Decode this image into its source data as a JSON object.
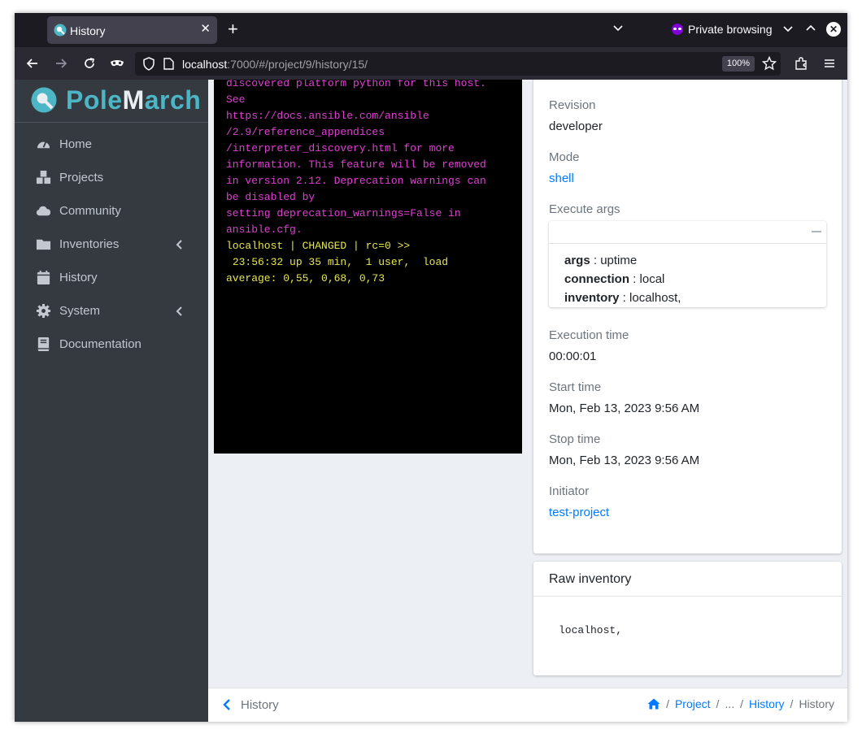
{
  "browser": {
    "tab_title": "History",
    "private_label": "Private browsing",
    "url_host": "localhost",
    "url_rest": ":7000/#/project/9/history/15/",
    "zoom": "100%"
  },
  "sidebar": {
    "brand_a": "Pole",
    "brand_b": "M",
    "brand_c": "arch",
    "items": [
      {
        "label": "Home"
      },
      {
        "label": "Projects"
      },
      {
        "label": "Community"
      },
      {
        "label": "Inventories"
      },
      {
        "label": "History"
      },
      {
        "label": "System"
      },
      {
        "label": "Documentation"
      }
    ]
  },
  "console": {
    "lines": [
      {
        "text": "discovered platform python for this host.",
        "kind": "warn"
      },
      {
        "text": "See",
        "kind": "warn"
      },
      {
        "text": "https://docs.ansible.com/ansible",
        "kind": "warn"
      },
      {
        "text": "/2.9/reference_appendices",
        "kind": "warn"
      },
      {
        "text": "/interpreter_discovery.html for more",
        "kind": "warn"
      },
      {
        "text": "information. This feature will be removed",
        "kind": "warn"
      },
      {
        "text": "in version 2.12. Deprecation warnings can",
        "kind": "warn"
      },
      {
        "text": "be disabled by",
        "kind": "warn"
      },
      {
        "text": "setting deprecation_warnings=False in",
        "kind": "warn"
      },
      {
        "text": "ansible.cfg.",
        "kind": "warn"
      },
      {
        "text": "localhost | CHANGED | rc=0 >>",
        "kind": "ok"
      },
      {
        "text": " 23:56:32 up 35 min,  1 user,  load",
        "kind": "ok"
      },
      {
        "text": "average: 0,55, 0,68, 0,73",
        "kind": "ok"
      }
    ]
  },
  "details": {
    "revision_label": "Revision",
    "revision": "developer",
    "mode_label": "Mode",
    "mode": "shell",
    "execute_args_label": "Execute args",
    "args": [
      {
        "key": "args",
        "value": "uptime"
      },
      {
        "key": "connection",
        "value": "local"
      },
      {
        "key": "inventory",
        "value": "localhost,"
      }
    ],
    "execution_time_label": "Execution time",
    "execution_time": "00:00:01",
    "start_time_label": "Start time",
    "start_time": "Mon, Feb 13, 2023 9:56 AM",
    "stop_time_label": "Stop time",
    "stop_time": "Mon, Feb 13, 2023 9:56 AM",
    "initiator_label": "Initiator",
    "initiator": "test-project"
  },
  "raw_inventory": {
    "title": "Raw inventory",
    "content": "localhost,"
  },
  "footer": {
    "back_label": "History",
    "crumb_project": "Project",
    "crumb_ellipsis": "...",
    "crumb_history_link": "History",
    "crumb_current": "History"
  }
}
